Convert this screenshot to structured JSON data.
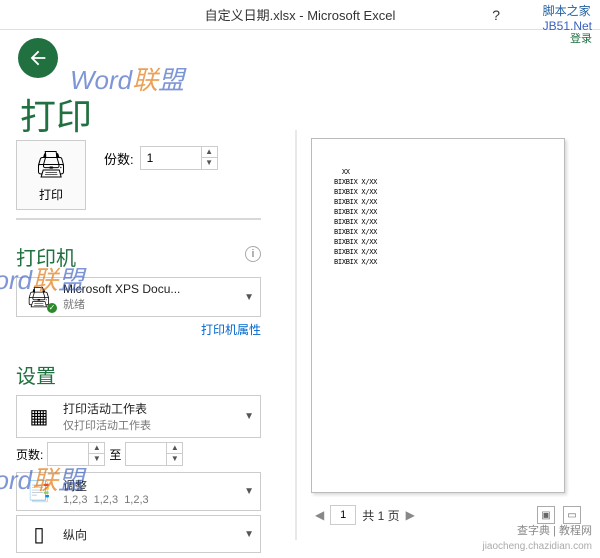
{
  "titlebar": {
    "text": "自定义日期.xlsx - Microsoft Excel",
    "help": "?",
    "right_label": "脚本之家",
    "right_sub": "JB51.Net",
    "login": "登录"
  },
  "page_title": "打印",
  "print_button_label": "打印",
  "copies": {
    "label": "份数:",
    "value": "1"
  },
  "printer": {
    "heading": "打印机",
    "name": "Microsoft XPS Docu...",
    "status": "就绪",
    "props_link": "打印机属性"
  },
  "settings": {
    "heading": "设置",
    "scope_main": "打印活动工作表",
    "scope_sub": "仅打印活动工作表",
    "pages_label": "页数:",
    "pages_to": "至",
    "collate_main": "调整",
    "collate_sub1": "1,2,3",
    "collate_sub2": "1,2,3",
    "collate_sub3": "1,2,3",
    "orientation": "纵向"
  },
  "preview": {
    "current_page": "1",
    "total_label": "共 1 页",
    "lines": [
      "  XX",
      "BIXBIX X/XX",
      "BIXBIX X/XX",
      "BIXBIX X/XX",
      "BIXBIX X/XX",
      "BIXBIX X/XX",
      "BIXBIX X/XX",
      "BIXBIX X/XX",
      "BIXBIX X/XX",
      "BIXBIX X/XX"
    ]
  },
  "watermark": {
    "word": "Word",
    "lian": "联",
    "meng": "盟"
  },
  "footer": {
    "site": "查字典 | 教程网",
    "url": "jiaocheng.chazidian.com"
  }
}
